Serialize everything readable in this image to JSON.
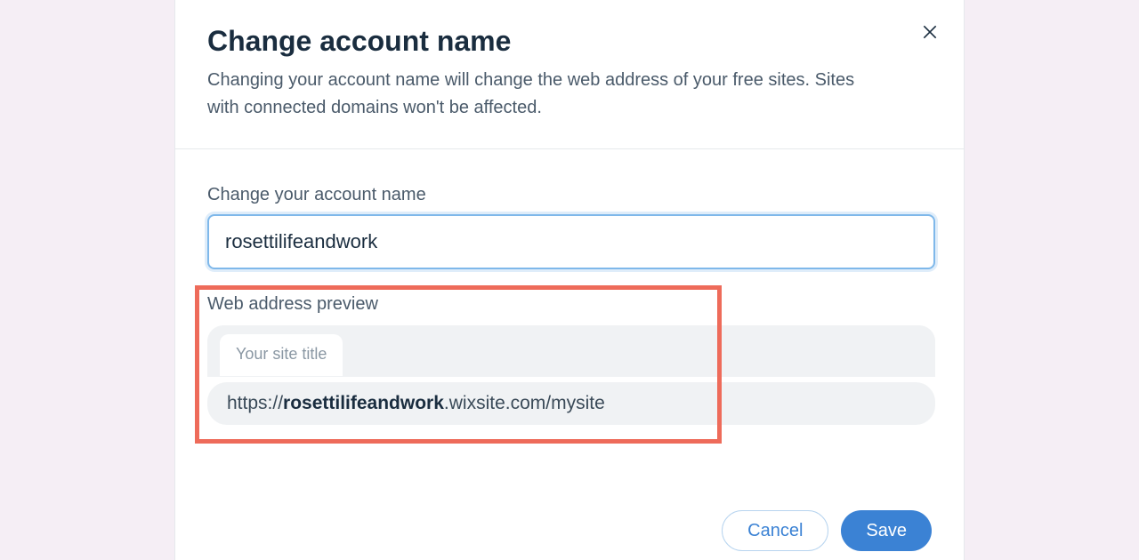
{
  "modal": {
    "title": "Change account name",
    "subtitle": "Changing your account name will change the web address of your free sites. Sites with connected domains won't be affected."
  },
  "field": {
    "label": "Change your account name",
    "value": "rosettilifeandwork"
  },
  "preview": {
    "label": "Web address preview",
    "tab_label": "Your site title",
    "url_prefix": "https://",
    "url_bold": "rosettilifeandwork",
    "url_suffix": ".wixsite.com/mysite"
  },
  "buttons": {
    "cancel": "Cancel",
    "save": "Save"
  }
}
